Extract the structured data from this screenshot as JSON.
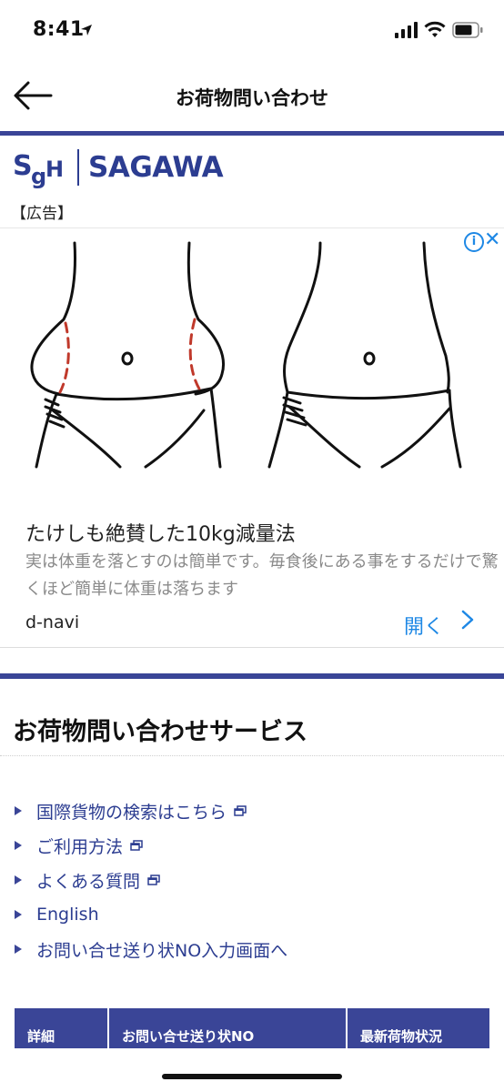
{
  "status_bar": {
    "time": "8:41"
  },
  "nav": {
    "title": "お荷物問い合わせ"
  },
  "logo": {
    "mark": "SgH",
    "brand": "SAGAWA"
  },
  "ad": {
    "label": "【広告】",
    "headline": "たけしも絶賛した10kg減量法",
    "description": "実は体重を落とすのは簡単です。毎食後にある事をするだけで驚くほど簡単に体重は落ちます",
    "source": "d-navi",
    "open_label": "開く"
  },
  "section": {
    "title": "お荷物問い合わせサービス"
  },
  "links": [
    {
      "label": "国際貨物の検索はこちら",
      "external": true
    },
    {
      "label": "ご利用方法",
      "external": true
    },
    {
      "label": "よくある質問",
      "external": true
    },
    {
      "label": "English",
      "external": false
    },
    {
      "label": "お問い合せ送り状NO入力画面へ",
      "external": false
    }
  ],
  "table": {
    "headers": [
      "詳細",
      "お問い合せ送り状NO",
      "最新荷物状況"
    ]
  },
  "colors": {
    "brand_navy": "#3a4597",
    "link_blue": "#2c3d91",
    "ad_blue": "#1e88e5",
    "ad_dash": "#c0392b"
  }
}
